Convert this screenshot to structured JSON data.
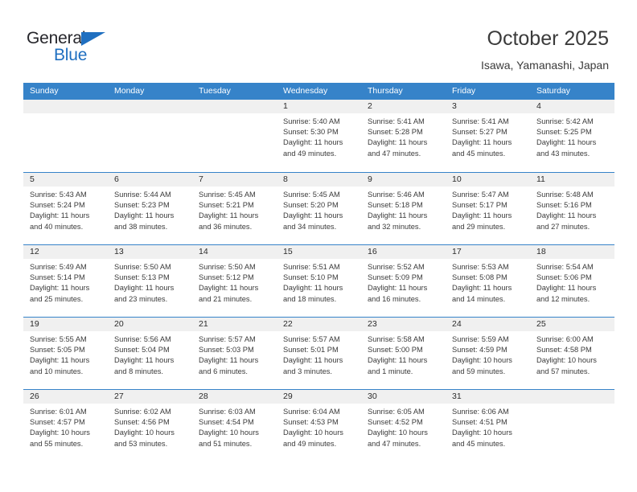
{
  "brand": {
    "name_part1": "General",
    "name_part2": "Blue",
    "triangle_color": "#1f6fc0"
  },
  "header": {
    "title": "October 2025",
    "subtitle": "Isawa, Yamanashi, Japan",
    "accent_color": "#3683c9"
  },
  "weekdays": [
    "Sunday",
    "Monday",
    "Tuesday",
    "Wednesday",
    "Thursday",
    "Friday",
    "Saturday"
  ],
  "weeks": [
    [
      {
        "day": "",
        "sunrise": "",
        "sunset": "",
        "daylight": "",
        "empty": true
      },
      {
        "day": "",
        "sunrise": "",
        "sunset": "",
        "daylight": "",
        "empty": true
      },
      {
        "day": "",
        "sunrise": "",
        "sunset": "",
        "daylight": "",
        "empty": true
      },
      {
        "day": "1",
        "sunrise": "Sunrise: 5:40 AM",
        "sunset": "Sunset: 5:30 PM",
        "daylight": "Daylight: 11 hours and 49 minutes."
      },
      {
        "day": "2",
        "sunrise": "Sunrise: 5:41 AM",
        "sunset": "Sunset: 5:28 PM",
        "daylight": "Daylight: 11 hours and 47 minutes."
      },
      {
        "day": "3",
        "sunrise": "Sunrise: 5:41 AM",
        "sunset": "Sunset: 5:27 PM",
        "daylight": "Daylight: 11 hours and 45 minutes."
      },
      {
        "day": "4",
        "sunrise": "Sunrise: 5:42 AM",
        "sunset": "Sunset: 5:25 PM",
        "daylight": "Daylight: 11 hours and 43 minutes."
      }
    ],
    [
      {
        "day": "5",
        "sunrise": "Sunrise: 5:43 AM",
        "sunset": "Sunset: 5:24 PM",
        "daylight": "Daylight: 11 hours and 40 minutes."
      },
      {
        "day": "6",
        "sunrise": "Sunrise: 5:44 AM",
        "sunset": "Sunset: 5:23 PM",
        "daylight": "Daylight: 11 hours and 38 minutes."
      },
      {
        "day": "7",
        "sunrise": "Sunrise: 5:45 AM",
        "sunset": "Sunset: 5:21 PM",
        "daylight": "Daylight: 11 hours and 36 minutes."
      },
      {
        "day": "8",
        "sunrise": "Sunrise: 5:45 AM",
        "sunset": "Sunset: 5:20 PM",
        "daylight": "Daylight: 11 hours and 34 minutes."
      },
      {
        "day": "9",
        "sunrise": "Sunrise: 5:46 AM",
        "sunset": "Sunset: 5:18 PM",
        "daylight": "Daylight: 11 hours and 32 minutes."
      },
      {
        "day": "10",
        "sunrise": "Sunrise: 5:47 AM",
        "sunset": "Sunset: 5:17 PM",
        "daylight": "Daylight: 11 hours and 29 minutes."
      },
      {
        "day": "11",
        "sunrise": "Sunrise: 5:48 AM",
        "sunset": "Sunset: 5:16 PM",
        "daylight": "Daylight: 11 hours and 27 minutes."
      }
    ],
    [
      {
        "day": "12",
        "sunrise": "Sunrise: 5:49 AM",
        "sunset": "Sunset: 5:14 PM",
        "daylight": "Daylight: 11 hours and 25 minutes."
      },
      {
        "day": "13",
        "sunrise": "Sunrise: 5:50 AM",
        "sunset": "Sunset: 5:13 PM",
        "daylight": "Daylight: 11 hours and 23 minutes."
      },
      {
        "day": "14",
        "sunrise": "Sunrise: 5:50 AM",
        "sunset": "Sunset: 5:12 PM",
        "daylight": "Daylight: 11 hours and 21 minutes."
      },
      {
        "day": "15",
        "sunrise": "Sunrise: 5:51 AM",
        "sunset": "Sunset: 5:10 PM",
        "daylight": "Daylight: 11 hours and 18 minutes."
      },
      {
        "day": "16",
        "sunrise": "Sunrise: 5:52 AM",
        "sunset": "Sunset: 5:09 PM",
        "daylight": "Daylight: 11 hours and 16 minutes."
      },
      {
        "day": "17",
        "sunrise": "Sunrise: 5:53 AM",
        "sunset": "Sunset: 5:08 PM",
        "daylight": "Daylight: 11 hours and 14 minutes."
      },
      {
        "day": "18",
        "sunrise": "Sunrise: 5:54 AM",
        "sunset": "Sunset: 5:06 PM",
        "daylight": "Daylight: 11 hours and 12 minutes."
      }
    ],
    [
      {
        "day": "19",
        "sunrise": "Sunrise: 5:55 AM",
        "sunset": "Sunset: 5:05 PM",
        "daylight": "Daylight: 11 hours and 10 minutes."
      },
      {
        "day": "20",
        "sunrise": "Sunrise: 5:56 AM",
        "sunset": "Sunset: 5:04 PM",
        "daylight": "Daylight: 11 hours and 8 minutes."
      },
      {
        "day": "21",
        "sunrise": "Sunrise: 5:57 AM",
        "sunset": "Sunset: 5:03 PM",
        "daylight": "Daylight: 11 hours and 6 minutes."
      },
      {
        "day": "22",
        "sunrise": "Sunrise: 5:57 AM",
        "sunset": "Sunset: 5:01 PM",
        "daylight": "Daylight: 11 hours and 3 minutes."
      },
      {
        "day": "23",
        "sunrise": "Sunrise: 5:58 AM",
        "sunset": "Sunset: 5:00 PM",
        "daylight": "Daylight: 11 hours and 1 minute."
      },
      {
        "day": "24",
        "sunrise": "Sunrise: 5:59 AM",
        "sunset": "Sunset: 4:59 PM",
        "daylight": "Daylight: 10 hours and 59 minutes."
      },
      {
        "day": "25",
        "sunrise": "Sunrise: 6:00 AM",
        "sunset": "Sunset: 4:58 PM",
        "daylight": "Daylight: 10 hours and 57 minutes."
      }
    ],
    [
      {
        "day": "26",
        "sunrise": "Sunrise: 6:01 AM",
        "sunset": "Sunset: 4:57 PM",
        "daylight": "Daylight: 10 hours and 55 minutes."
      },
      {
        "day": "27",
        "sunrise": "Sunrise: 6:02 AM",
        "sunset": "Sunset: 4:56 PM",
        "daylight": "Daylight: 10 hours and 53 minutes."
      },
      {
        "day": "28",
        "sunrise": "Sunrise: 6:03 AM",
        "sunset": "Sunset: 4:54 PM",
        "daylight": "Daylight: 10 hours and 51 minutes."
      },
      {
        "day": "29",
        "sunrise": "Sunrise: 6:04 AM",
        "sunset": "Sunset: 4:53 PM",
        "daylight": "Daylight: 10 hours and 49 minutes."
      },
      {
        "day": "30",
        "sunrise": "Sunrise: 6:05 AM",
        "sunset": "Sunset: 4:52 PM",
        "daylight": "Daylight: 10 hours and 47 minutes."
      },
      {
        "day": "31",
        "sunrise": "Sunrise: 6:06 AM",
        "sunset": "Sunset: 4:51 PM",
        "daylight": "Daylight: 10 hours and 45 minutes."
      },
      {
        "day": "",
        "sunrise": "",
        "sunset": "",
        "daylight": "",
        "empty": true
      }
    ]
  ]
}
